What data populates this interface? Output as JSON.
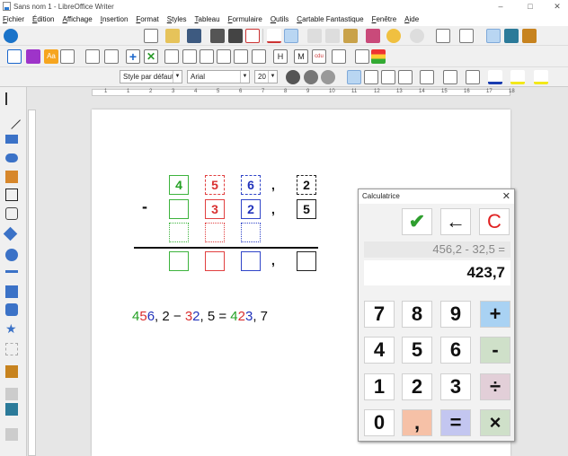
{
  "window": {
    "title": "Sans nom 1 - LibreOffice Writer",
    "controls": {
      "minimize": "–",
      "maximize": "□",
      "close": "✕"
    }
  },
  "menu": [
    "Fichier",
    "Édition",
    "Affichage",
    "Insertion",
    "Format",
    "Styles",
    "Tableau",
    "Formulaire",
    "Outils",
    "Cartable Fantastique",
    "Fenêtre",
    "Aide"
  ],
  "toolbar2": {
    "labels": [
      "Aa",
      "H",
      "M",
      "cdu"
    ]
  },
  "format_bar": {
    "paragraph_style": "Style par défaut",
    "font_name": "Arial",
    "font_size": "20"
  },
  "ruler": {
    "numbers": [
      "1",
      "1",
      "2",
      "3",
      "4",
      "5",
      "6",
      "7",
      "8",
      "9",
      "10",
      "11",
      "12",
      "13",
      "14",
      "15",
      "16",
      "17",
      "18"
    ]
  },
  "document": {
    "operation": {
      "row1": {
        "digits": [
          "4",
          "5",
          "6"
        ],
        "comma": ",",
        "decimal": "2"
      },
      "row2": {
        "sign": "-",
        "digits": [
          "",
          "3",
          "2"
        ],
        "comma": ",",
        "decimal": "5"
      },
      "result_row": {
        "comma": ","
      }
    },
    "equation": [
      {
        "t": "4",
        "c": "g"
      },
      {
        "t": "5",
        "c": "r"
      },
      {
        "t": "6",
        "c": "b"
      },
      {
        "t": ", 2 − ",
        "c": "k"
      },
      {
        "t": "3",
        "c": "r"
      },
      {
        "t": "2",
        "c": "b"
      },
      {
        "t": ", 5 = ",
        "c": "k"
      },
      {
        "t": "4",
        "c": "g"
      },
      {
        "t": "2",
        "c": "r"
      },
      {
        "t": "3",
        "c": "b"
      },
      {
        "t": ", 7",
        "c": "k"
      }
    ]
  },
  "calculator": {
    "title": "Calculatrice",
    "close": "✕",
    "buttons_top": {
      "ok": "✔",
      "back": "←",
      "clear": "C"
    },
    "expression": "456,2 - 32,5 =",
    "result": "423,7",
    "keys": {
      "k7": "7",
      "k8": "8",
      "k9": "9",
      "plus": "+",
      "k4": "4",
      "k5": "5",
      "k6": "6",
      "minus": "-",
      "k1": "1",
      "k2": "2",
      "k3": "3",
      "div": "÷",
      "k0": "0",
      "comma": ",",
      "eq": "=",
      "mul": "×"
    },
    "colors": {
      "ok": "#2e9e2e",
      "clear": "#e02020",
      "plus_bg": "#a9d2f3",
      "minus_bg": "#cfe0c9",
      "div_bg": "#e2cfd8",
      "comma_bg": "#f6c1a7",
      "eq_bg": "#c3c6f0",
      "mul_bg": "#cfe0c9"
    }
  }
}
